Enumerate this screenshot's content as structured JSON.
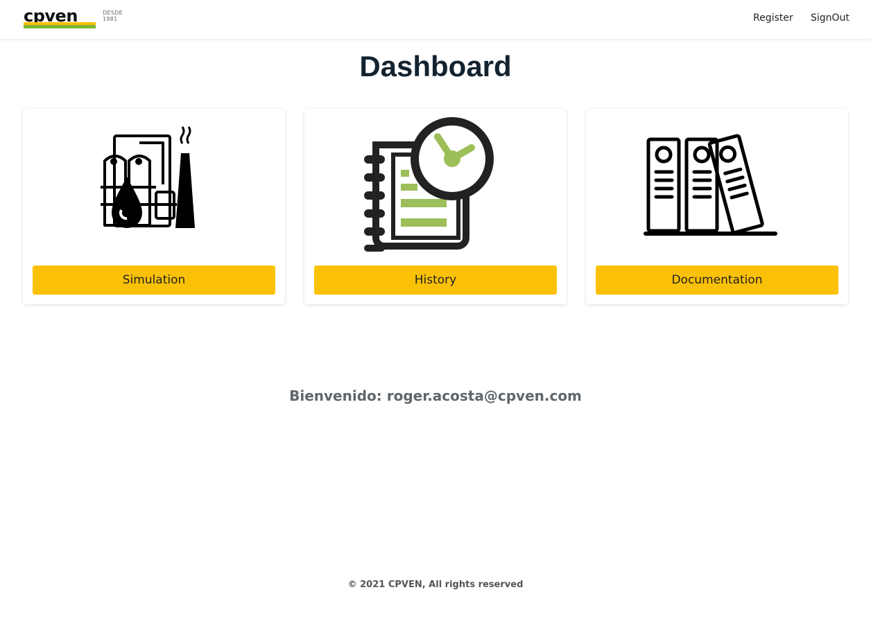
{
  "brand": {
    "logo_text": "cpven",
    "since_line1": "DESDE",
    "since_line2": "1981"
  },
  "nav": {
    "register_label": "Register",
    "signout_label": "SignOut"
  },
  "page": {
    "title": "Dashboard"
  },
  "cards": [
    {
      "icon": "refinery-icon",
      "label": "Simulation"
    },
    {
      "icon": "history-notebook-clock-icon",
      "label": "History"
    },
    {
      "icon": "binders-documentation-icon",
      "label": "Documentation"
    }
  ],
  "welcome_text": "Bienvenido: roger.acosta@cpven.com",
  "footer_text": "© 2021 CPVEN, All rights reserved",
  "colors": {
    "accent_yellow": "#fbc107",
    "accent_green": "#9cbf5a",
    "title": "#132330"
  }
}
